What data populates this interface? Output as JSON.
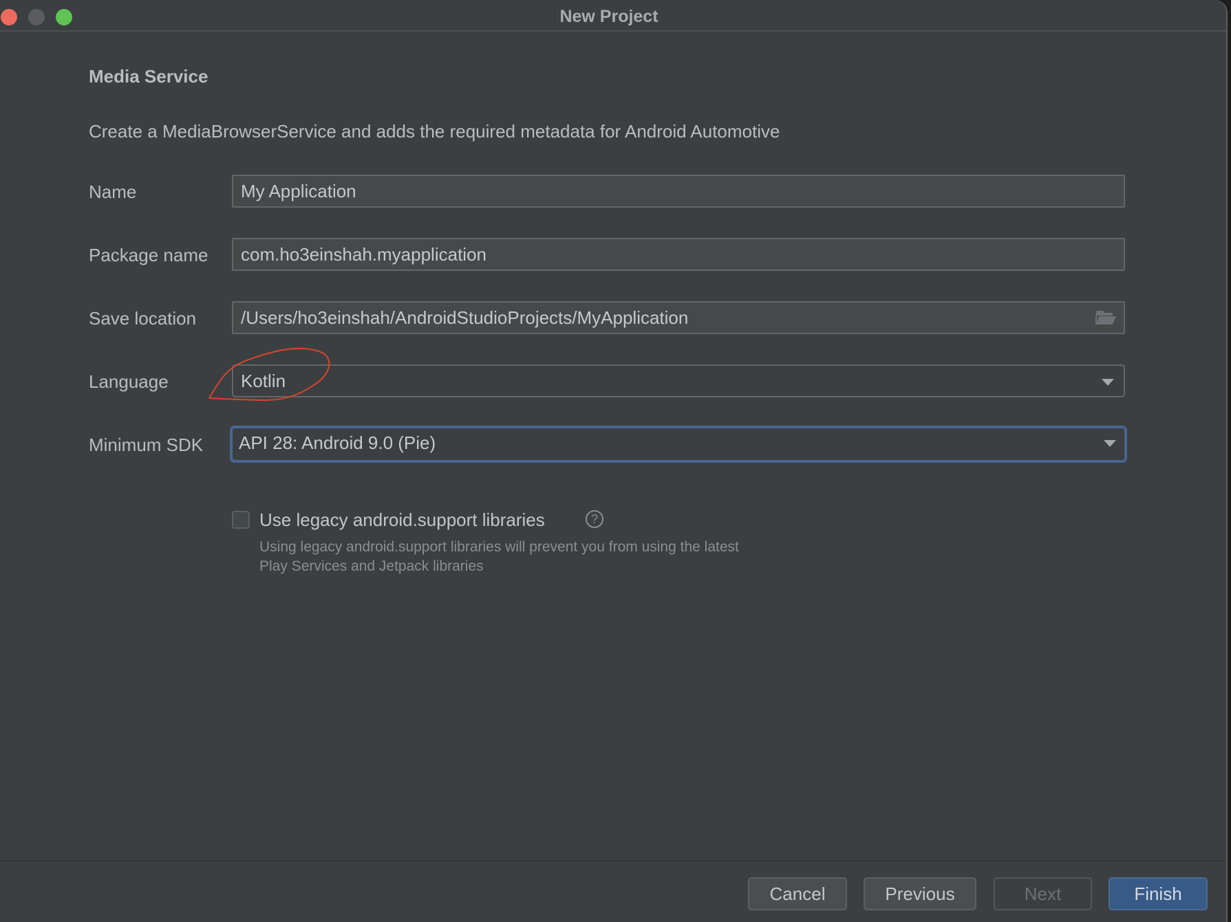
{
  "window": {
    "title": "New Project",
    "controls": [
      "close",
      "minimize",
      "maximize"
    ]
  },
  "page": {
    "heading": "Media Service",
    "description": "Create a MediaBrowserService and adds the required metadata for Android Automotive"
  },
  "form": {
    "name": {
      "label": "Name",
      "value": "My Application"
    },
    "package_name": {
      "label": "Package name",
      "value": "com.ho3einshah.myapplication"
    },
    "save_location": {
      "label": "Save location",
      "value": "/Users/ho3einshah/AndroidStudioProjects/MyApplication",
      "icon": "folder-icon"
    },
    "language": {
      "label": "Language",
      "value": "Kotlin"
    },
    "minimum_sdk": {
      "label": "Minimum SDK",
      "value": "API 28: Android 9.0 (Pie)"
    },
    "legacy_support": {
      "label": "Use legacy android.support libraries",
      "checked": false,
      "help_icon": "?",
      "hint": "Using legacy android.support libraries will prevent you from using the latest Play Services and Jetpack libraries"
    }
  },
  "annotation": {
    "color": "#d9452c",
    "target": "Kotlin"
  },
  "buttons": {
    "cancel": "Cancel",
    "previous": "Previous",
    "next": "Next",
    "finish": "Finish"
  },
  "colors": {
    "background": "#3c3f41",
    "focus_border": "#486693",
    "primary_button": "#375a87"
  }
}
